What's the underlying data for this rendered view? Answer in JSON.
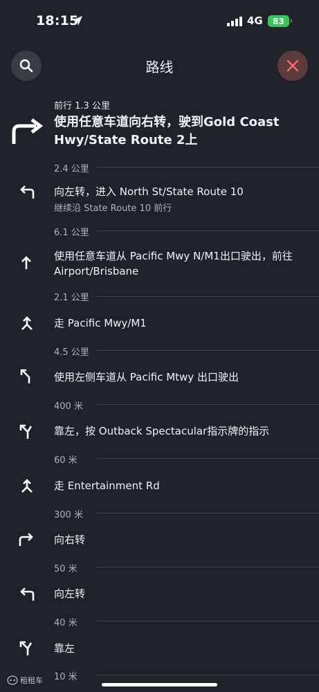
{
  "status": {
    "time": "18:15",
    "network": "4G",
    "battery": "83"
  },
  "header": {
    "title": "路线"
  },
  "steps": [
    {
      "icon": "turn-right-large-icon",
      "pre": "前行 1.3 公里",
      "main": "使用任意车道向右转，驶到Gold Coast Hwy/State Route 2上",
      "distance": "2.4 公里"
    },
    {
      "icon": "turn-left-icon",
      "main": "向左转，进入 North St/State Route 10",
      "sub": "继续沿 State Route 10 前行",
      "distance": "6.1 公里"
    },
    {
      "icon": "straight-arrow-icon",
      "main": "使用任意车道从 Pacific Mwy N/M1出口驶出，前往 Airport/Brisbane",
      "distance": "2.1 公里"
    },
    {
      "icon": "merge-icon",
      "main": "走 Pacific Mwy/M1",
      "distance": "4.5 公里"
    },
    {
      "icon": "exit-left-icon",
      "main": "使用左侧车道从 Pacific Mtwy 出口驶出",
      "distance": "400 米"
    },
    {
      "icon": "keep-left-icon",
      "main": "靠左，按 Outback Spectacular指示牌的指示",
      "distance": "60 米"
    },
    {
      "icon": "merge-icon",
      "main": "走 Entertainment Rd",
      "distance": "300 米"
    },
    {
      "icon": "turn-right-icon",
      "main": "向右转",
      "distance": "50 米"
    },
    {
      "icon": "turn-left-icon",
      "main": "向左转",
      "distance": "40 米"
    },
    {
      "icon": "keep-left-icon",
      "main": "靠左",
      "distance": "10 米"
    }
  ],
  "watermark": "租租车"
}
